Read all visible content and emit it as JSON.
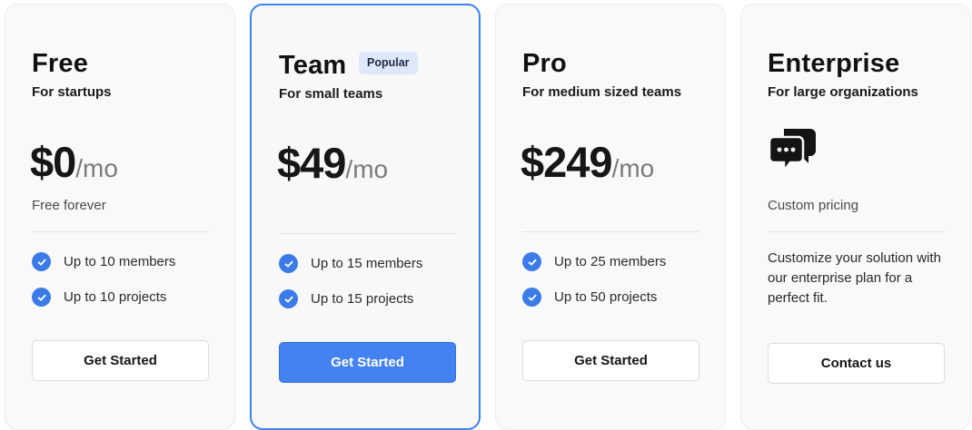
{
  "colors": {
    "accent": "#3b82f6",
    "check": "#3b7be8",
    "primary_button": "#4382f0",
    "badge_bg": "#dde8fb",
    "card_bg": "#f9f9f9"
  },
  "plans": [
    {
      "name": "Free",
      "subtitle": "For startups",
      "price": "$0",
      "per": "/mo",
      "note": "Free forever",
      "features": [
        "Up to 10 members",
        "Up to 10 projects"
      ],
      "cta": "Get Started"
    },
    {
      "name": "Team",
      "badge": "Popular",
      "subtitle": "For small teams",
      "price": "$49",
      "per": "/mo",
      "features": [
        "Up to 15 members",
        "Up to 15 projects"
      ],
      "cta": "Get Started"
    },
    {
      "name": "Pro",
      "subtitle": "For medium sized teams",
      "price": "$249",
      "per": "/mo",
      "features": [
        "Up to 25 members",
        "Up to 50 projects"
      ],
      "cta": "Get Started"
    },
    {
      "name": "Enterprise",
      "subtitle": "For large organizations",
      "icon": "chat-bubbles-icon",
      "note": "Custom pricing",
      "description": "Customize your solution with our enterprise plan for a perfect fit.",
      "cta": "Contact us"
    }
  ]
}
